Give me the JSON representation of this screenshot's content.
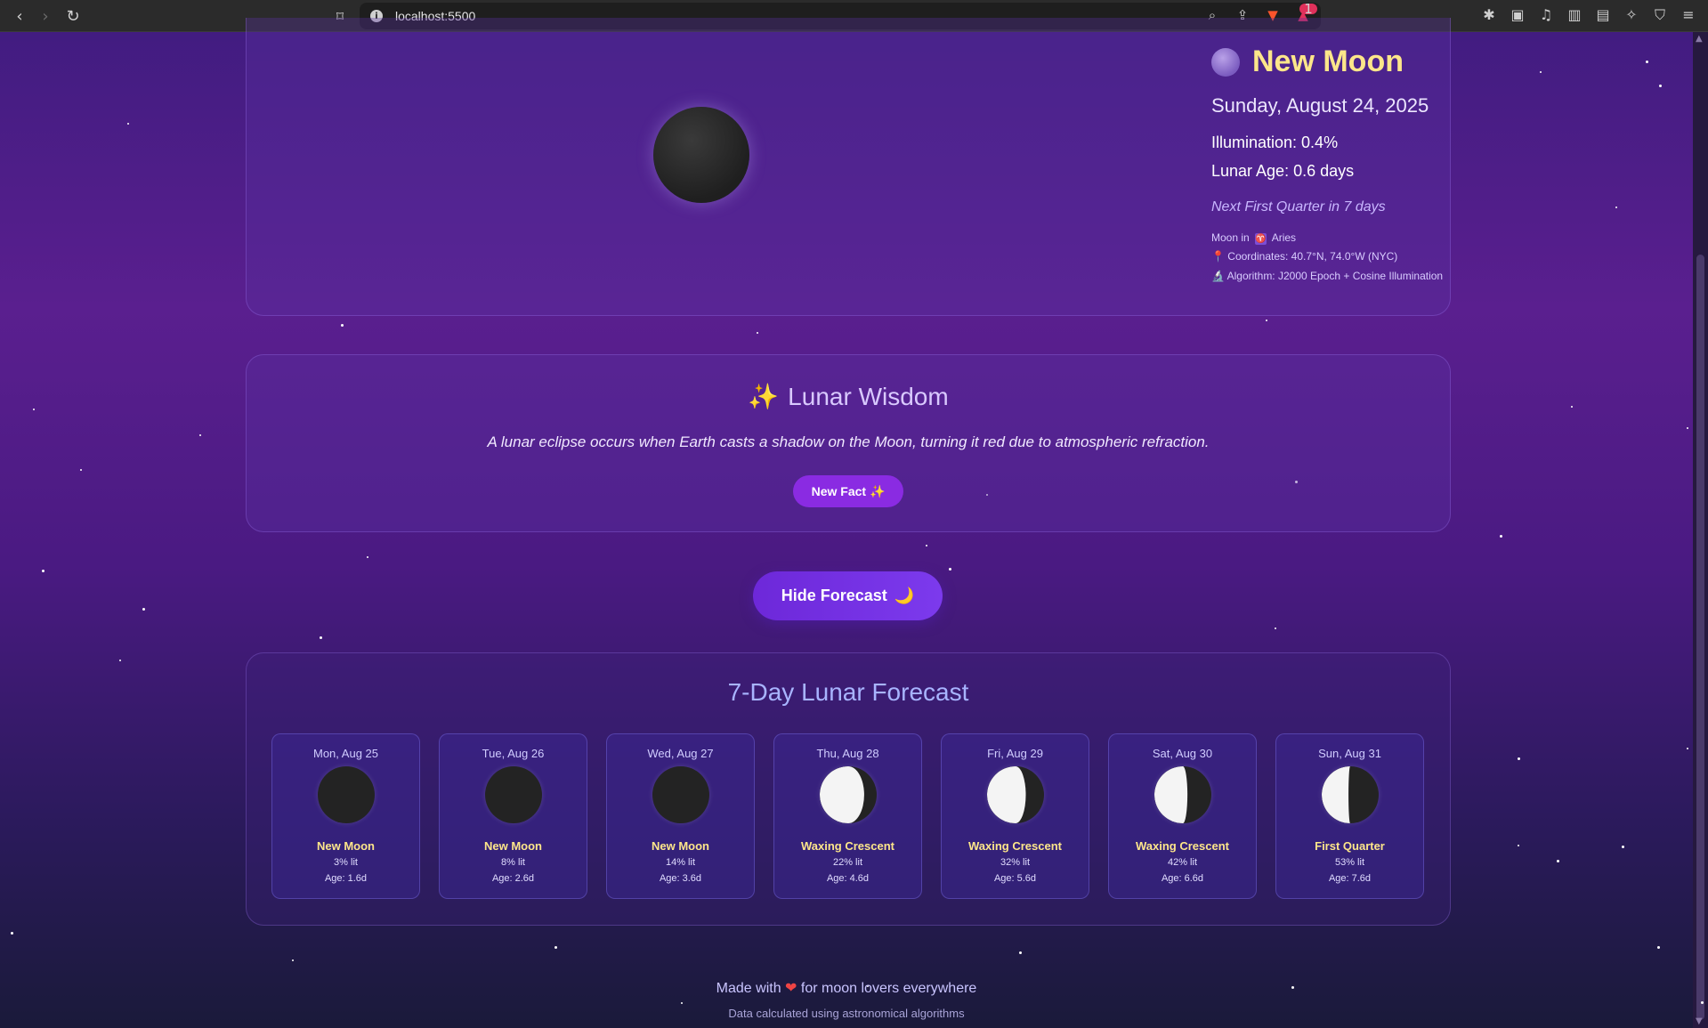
{
  "browser": {
    "url": "localhost:5500",
    "alert_count": "1"
  },
  "hero": {
    "phase_name": "New Moon",
    "date": "Sunday, August 24, 2025",
    "illumination": "Illumination: 0.4%",
    "lunar_age": "Lunar Age: 0.6 days",
    "next_phase": "Next First Quarter in 7 days",
    "moon_in_prefix": "Moon in",
    "zodiac_symbol": "♈",
    "zodiac_name": "Aries",
    "coordinates": "Coordinates: 40.7°N, 74.0°W (NYC)",
    "algorithm": "Algorithm: J2000 Epoch + Cosine Illumination"
  },
  "wisdom": {
    "title": "Lunar Wisdom",
    "fact": "A lunar eclipse occurs when Earth casts a shadow on the Moon, turning it red due to atmospheric refraction.",
    "button_label": "New Fact ✨"
  },
  "toggle": {
    "label": "Hide Forecast",
    "icon": "🌙"
  },
  "forecast": {
    "title": "7-Day Lunar Forecast",
    "days": [
      {
        "label": "Mon, Aug 25",
        "phase": "New Moon",
        "lit": "3% lit",
        "age": "Age: 1.6d",
        "illumination": 0.03
      },
      {
        "label": "Tue, Aug 26",
        "phase": "New Moon",
        "lit": "8% lit",
        "age": "Age: 2.6d",
        "illumination": 0.08
      },
      {
        "label": "Wed, Aug 27",
        "phase": "New Moon",
        "lit": "14% lit",
        "age": "Age: 3.6d",
        "illumination": 0.14
      },
      {
        "label": "Thu, Aug 28",
        "phase": "Waxing Crescent",
        "lit": "22% lit",
        "age": "Age: 4.6d",
        "illumination": 0.22
      },
      {
        "label": "Fri, Aug 29",
        "phase": "Waxing Crescent",
        "lit": "32% lit",
        "age": "Age: 5.6d",
        "illumination": 0.32
      },
      {
        "label": "Sat, Aug 30",
        "phase": "Waxing Crescent",
        "lit": "42% lit",
        "age": "Age: 6.6d",
        "illumination": 0.42
      },
      {
        "label": "Sun, Aug 31",
        "phase": "First Quarter",
        "lit": "53% lit",
        "age": "Age: 7.6d",
        "illumination": 0.53
      }
    ]
  },
  "footer": {
    "made_with_prefix": "Made with",
    "made_with_suffix": "for moon lovers everywhere",
    "note": "Data calculated using astronomical algorithms"
  },
  "colors": {
    "accent_gold": "#fde68a",
    "button_purple": "#8a2be2"
  }
}
